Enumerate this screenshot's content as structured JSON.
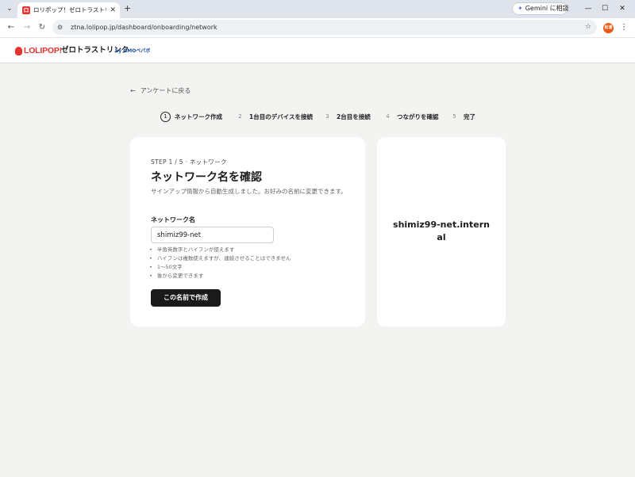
{
  "browser": {
    "tab_title": "ロリポップ！ゼロトラストリンク byGM",
    "tab_favicon": "ロ",
    "gemini_label": "Gemini に相談",
    "url": "ztna.lolipop.jp/dashboard/onboarding/network",
    "profile_label": "松浦"
  },
  "site": {
    "logo_text": "LOLIPOP!",
    "logo_sub": "ゼロトラストリンク",
    "logo_by": "by GMOペパボ"
  },
  "page": {
    "back_label": "アンケートに戻る",
    "steps": [
      {
        "num": "1",
        "label": "ネットワーク作成"
      },
      {
        "num": "2",
        "label": "1台目のデバイスを接続"
      },
      {
        "num": "3",
        "label": "2台目を接続"
      },
      {
        "num": "4",
        "label": "つながりを確認"
      },
      {
        "num": "5",
        "label": "完了"
      }
    ],
    "current_step": 1,
    "card": {
      "step_caption": "STEP 1 / 5 · ネットワーク",
      "title": "ネットワーク名を確認",
      "description": "サインアップ情報から自動生成しました。お好みの名前に変更できます。",
      "field_label": "ネットワーク名",
      "input_value": "shimiz99-net",
      "rules": [
        "半角英数字とハイフンが使えます",
        "ハイフンは複数使えますが、連続させることはできません",
        "1〜50文字",
        "後から変更できます"
      ],
      "submit_label": "この名前で作成"
    },
    "preview": {
      "network_fqdn": "shimiz99-net.internal"
    }
  }
}
